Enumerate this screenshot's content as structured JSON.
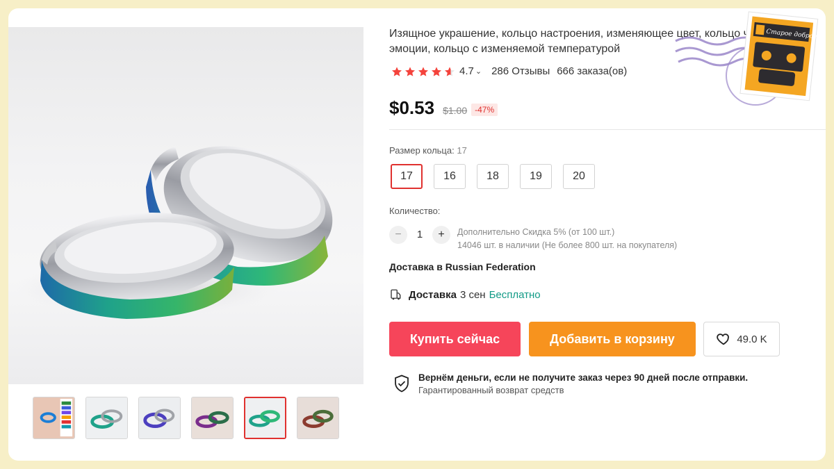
{
  "product": {
    "title": "Изящное украшение, кольцо настроения, изменяющее цвет, кольцо чувства эмоции, кольцо с изменяемой температурой",
    "rating": "4.7",
    "reviews": "286 Отзывы",
    "orders": "666 заказа(ов)",
    "price": "$0.53",
    "old_price": "$1.00",
    "discount": "-47%"
  },
  "options": {
    "size_label": "Размер кольца:",
    "size_selected": "17",
    "sizes": [
      "17",
      "16",
      "18",
      "19",
      "20"
    ],
    "qty_label": "Количество:",
    "qty_minus": "−",
    "qty_value": "1",
    "qty_plus": "+",
    "qty_note_1": "Дополнительно Скидка 5% (от 100 шт.)",
    "qty_note_2": "14046 шт. в наличии (Не более 800 шт. на покупателя)"
  },
  "shipping": {
    "region": "Доставка в Russian Federation",
    "label": "Доставка",
    "time": "3 сен",
    "cost": "Бесплатно"
  },
  "actions": {
    "buy_now": "Купить сейчас",
    "add_to_cart": "Добавить в корзину",
    "wishlist_count": "49.0 K"
  },
  "guarantee": {
    "main": "Вернём деньги, если не получите заказ через 90 дней после отправки.",
    "sub": "Гарантированный возврат средств"
  },
  "stamp": {
    "label": "Старое доброе"
  },
  "colors": {
    "accent_red": "#e0312f",
    "buy_button": "#f6455a",
    "cart_button": "#f7931e",
    "free_shipping": "#119a86",
    "page_background": "#f7efc7"
  },
  "icons": [
    "star-icon",
    "chevron-down-icon",
    "truck-icon",
    "heart-icon",
    "shield-check-icon"
  ]
}
